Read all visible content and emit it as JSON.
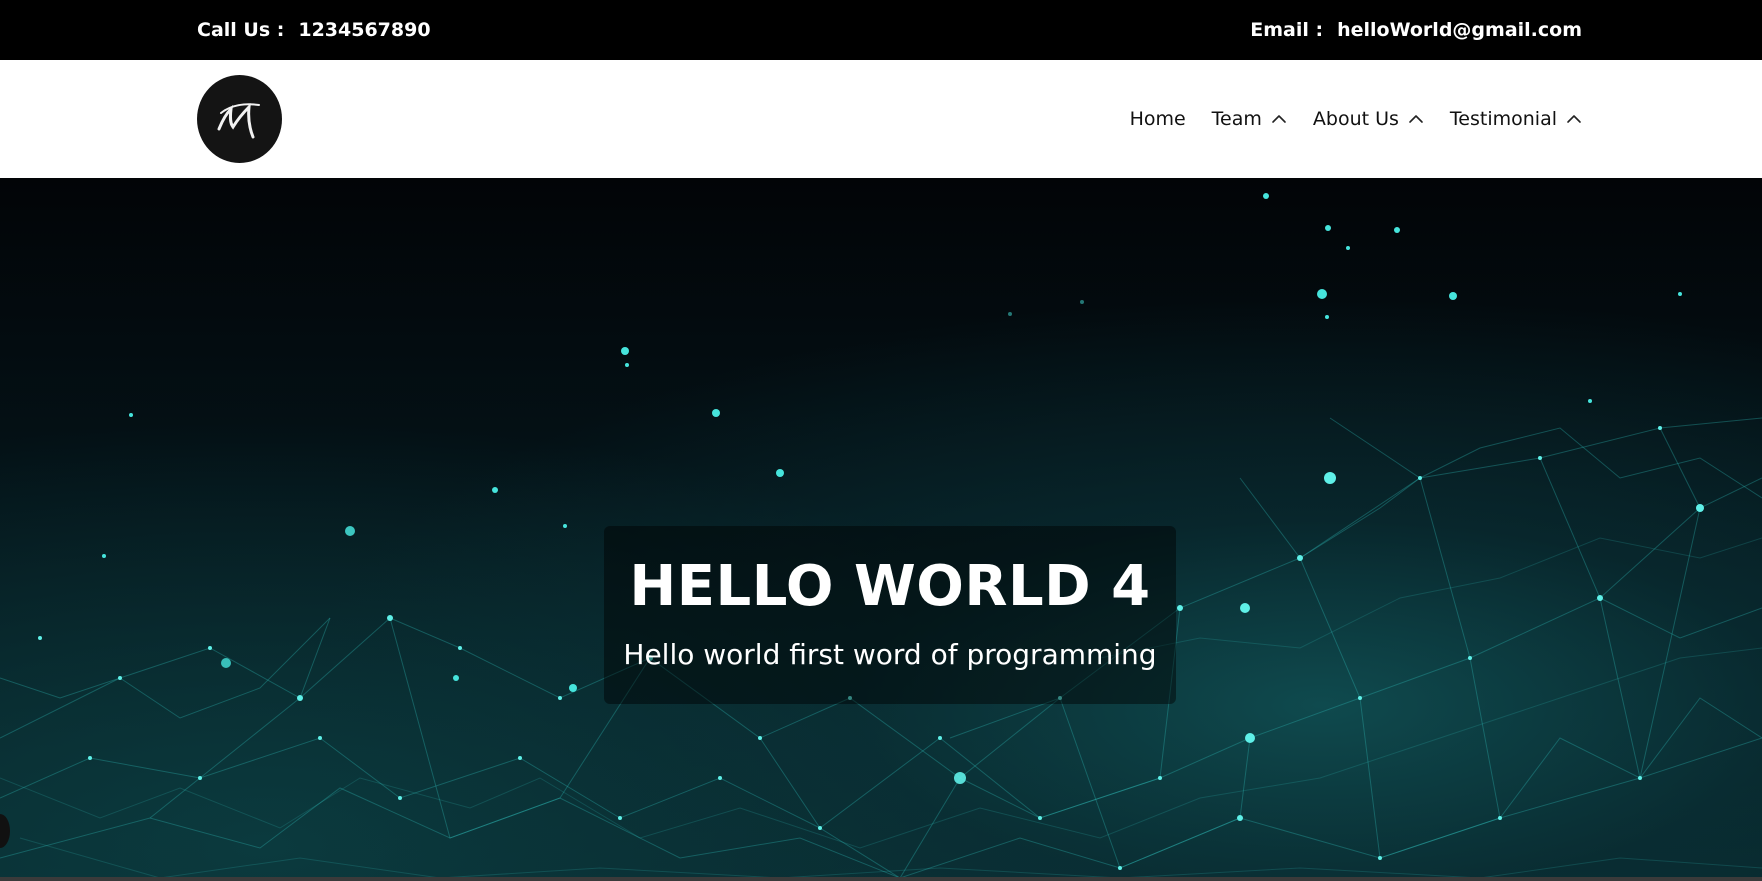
{
  "topbar": {
    "call_label": "Call Us :",
    "phone": "1234567890",
    "email_label": "Email :",
    "email": "helloWorld@gmail.com"
  },
  "nav": {
    "items": [
      {
        "label": "Home",
        "has_dropdown": false
      },
      {
        "label": "Team",
        "has_dropdown": true,
        "icon": "chevron-up-icon"
      },
      {
        "label": "About Us",
        "has_dropdown": true,
        "icon": "chevron-up-icon"
      },
      {
        "label": "Testimonial",
        "has_dropdown": true,
        "icon": "chevron-up-icon"
      }
    ]
  },
  "hero": {
    "title": "HELLO WORLD 4",
    "subtitle": "Hello world first word of programming"
  },
  "colors": {
    "topbar_bg": "#000000",
    "navbar_bg": "#ffffff",
    "accent_teal": "#3fd8d0"
  }
}
